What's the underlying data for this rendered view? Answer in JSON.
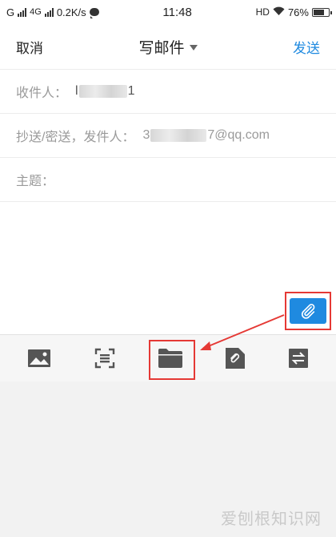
{
  "status_bar": {
    "carrier_g": "G",
    "network": "4G",
    "speed": "0.2K/s",
    "time": "11:48",
    "hd": "HD",
    "battery": "76%",
    "battery_level": 0.76
  },
  "nav": {
    "cancel": "取消",
    "title": "写邮件",
    "send": "发送"
  },
  "fields": {
    "to_label": "收件人：",
    "to_value_start": "l",
    "to_value_end": "1",
    "cc_label": "抄送/密送，发件人：",
    "cc_value_start": "3",
    "cc_value_end": "7@qq.com",
    "subject_label": "主题："
  },
  "toolbar": {
    "icons": [
      "image-icon",
      "scan-icon",
      "folder-icon",
      "attachment-icon",
      "transfer-icon"
    ]
  },
  "watermark": "爱刨根知识网",
  "colors": {
    "accent": "#1f8ae0",
    "highlight": "#e53935"
  }
}
